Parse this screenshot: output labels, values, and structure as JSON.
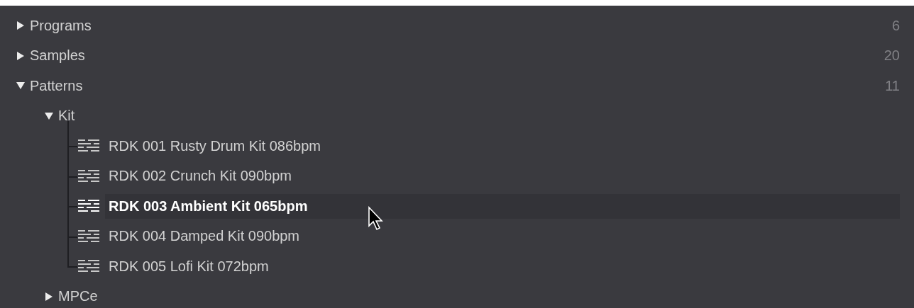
{
  "tree": [
    {
      "label": "Programs",
      "count": "6",
      "expanded": false
    },
    {
      "label": "Samples",
      "count": "20",
      "expanded": false
    },
    {
      "label": "Patterns",
      "count": "11",
      "expanded": true,
      "children": [
        {
          "label": "Kit",
          "expanded": true,
          "children": [
            {
              "label": "RDK 001 Rusty Drum Kit 086bpm",
              "selected": false
            },
            {
              "label": "RDK 002 Crunch Kit 090bpm",
              "selected": false
            },
            {
              "label": "RDK 003 Ambient Kit 065bpm",
              "selected": true
            },
            {
              "label": "RDK 004 Damped Kit 090bpm",
              "selected": false
            },
            {
              "label": "RDK 005 Lofi Kit 072bpm",
              "selected": false
            }
          ]
        },
        {
          "label": "MPCe",
          "expanded": false
        }
      ]
    }
  ]
}
